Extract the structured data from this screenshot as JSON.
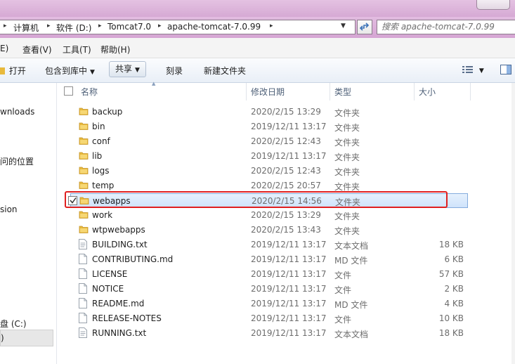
{
  "address": {
    "crumbs": [
      "计算机",
      "软件 (D:)",
      "Tomcat7.0",
      "apache-tomcat-7.0.99"
    ]
  },
  "search": {
    "placeholder": "搜索 apache-tomcat-7.0.99"
  },
  "menu": {
    "items": [
      "编辑(E)",
      "查看(V)",
      "工具(T)",
      "帮助(H)"
    ],
    "edit_partial": "E)"
  },
  "toolbar": {
    "open": "打开",
    "include_library": "包含到库中",
    "share": "共享",
    "burn": "刻录",
    "new_folder": "新建文件夹"
  },
  "nav": {
    "downloads": "wnloads",
    "recent": "问的位置",
    "version": "sion",
    "drive_c": "盘 (C:)",
    "drive_d": ")"
  },
  "columns": {
    "name": "名称",
    "modified": "修改日期",
    "type": "类型",
    "size": "大小"
  },
  "files": [
    {
      "name": "backup",
      "date": "2020/2/15 13:29",
      "type": "文件夹",
      "size": "",
      "icon": "folder-icon"
    },
    {
      "name": "bin",
      "date": "2019/12/11 13:17",
      "type": "文件夹",
      "size": "",
      "icon": "folder-icon"
    },
    {
      "name": "conf",
      "date": "2020/2/15 12:43",
      "type": "文件夹",
      "size": "",
      "icon": "folder-icon"
    },
    {
      "name": "lib",
      "date": "2019/12/11 13:17",
      "type": "文件夹",
      "size": "",
      "icon": "folder-icon"
    },
    {
      "name": "logs",
      "date": "2020/2/15 12:43",
      "type": "文件夹",
      "size": "",
      "icon": "folder-icon"
    },
    {
      "name": "temp",
      "date": "2020/2/15 20:57",
      "type": "文件夹",
      "size": "",
      "icon": "folder-icon"
    },
    {
      "name": "webapps",
      "date": "2020/2/15 14:56",
      "type": "文件夹",
      "size": "",
      "icon": "folder-icon",
      "selected": true
    },
    {
      "name": "work",
      "date": "2020/2/15 13:29",
      "type": "文件夹",
      "size": "",
      "icon": "folder-icon"
    },
    {
      "name": "wtpwebapps",
      "date": "2020/2/15 13:43",
      "type": "文件夹",
      "size": "",
      "icon": "folder-icon"
    },
    {
      "name": "BUILDING.txt",
      "date": "2019/12/11 13:17",
      "type": "文本文档",
      "size": "18 KB",
      "icon": "text-file-icon"
    },
    {
      "name": "CONTRIBUTING.md",
      "date": "2019/12/11 13:17",
      "type": "MD 文件",
      "size": "6 KB",
      "icon": "file-icon"
    },
    {
      "name": "LICENSE",
      "date": "2019/12/11 13:17",
      "type": "文件",
      "size": "57 KB",
      "icon": "file-icon"
    },
    {
      "name": "NOTICE",
      "date": "2019/12/11 13:17",
      "type": "文件",
      "size": "2 KB",
      "icon": "file-icon"
    },
    {
      "name": "README.md",
      "date": "2019/12/11 13:17",
      "type": "MD 文件",
      "size": "4 KB",
      "icon": "file-icon"
    },
    {
      "name": "RELEASE-NOTES",
      "date": "2019/12/11 13:17",
      "type": "文件",
      "size": "10 KB",
      "icon": "file-icon"
    },
    {
      "name": "RUNNING.txt",
      "date": "2019/12/11 13:17",
      "type": "文本文档",
      "size": "18 KB",
      "icon": "text-file-icon"
    }
  ],
  "colors": {
    "highlight_box": "#e02020",
    "selection": "#cfe3fb",
    "folder": "#e8b93c"
  }
}
